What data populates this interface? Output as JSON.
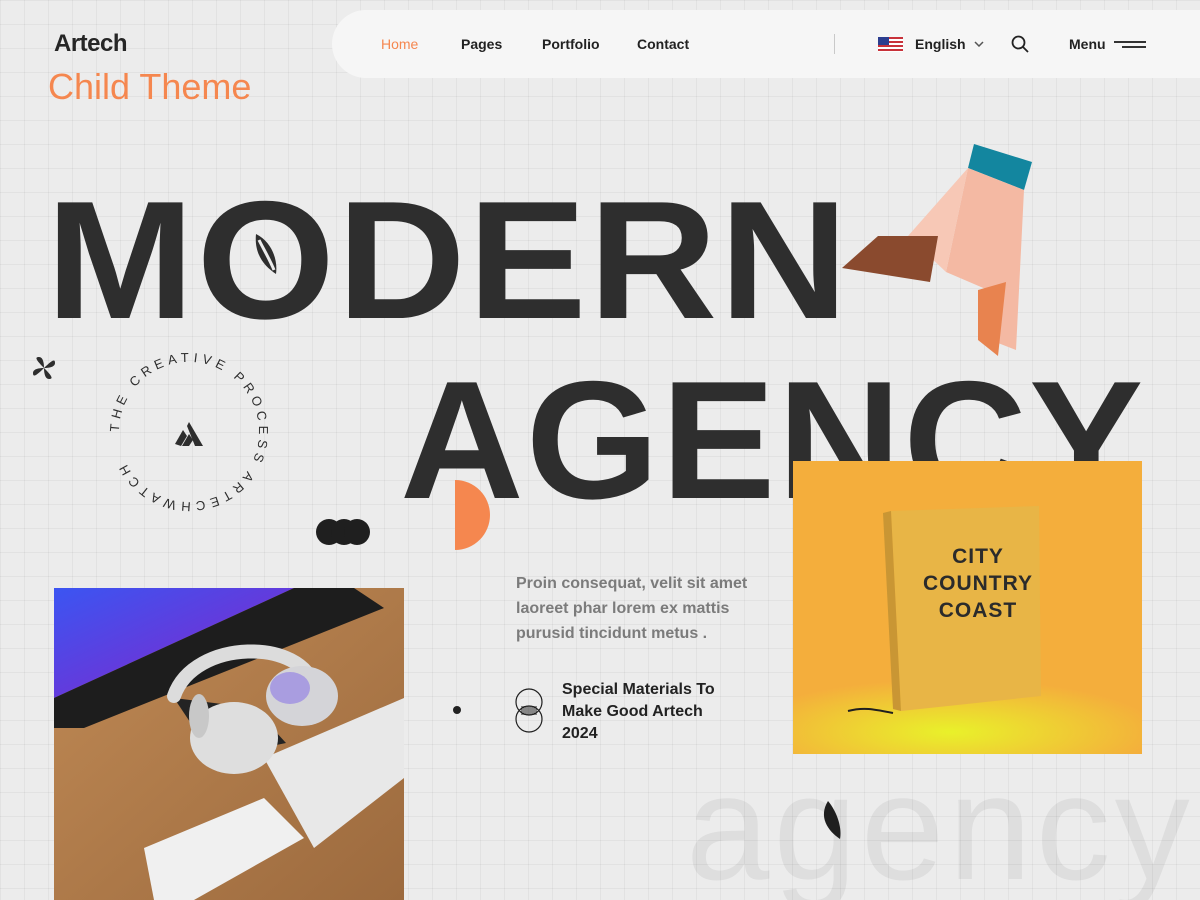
{
  "brand": {
    "logo": "Artech",
    "subtitle": "Child Theme"
  },
  "nav": {
    "items": [
      {
        "label": "Home",
        "active": true
      },
      {
        "label": "Pages",
        "active": false
      },
      {
        "label": "Portfolio",
        "active": false
      },
      {
        "label": "Contact",
        "active": false
      }
    ],
    "language": "English",
    "language_flag": "us-flag-icon",
    "menu_label": "Menu"
  },
  "hero": {
    "headline_1": "MODERN",
    "headline_2": "AGENCY",
    "badge_text": "THE CREATIVE PROCESS ARTECHWATCH",
    "body": "Proin consequat, velit sit amet laoreet phar lorem ex mattis purusid tincidunt metus .",
    "feature": "Special Materials To Make Good Artech 2024",
    "watermark": "agency"
  },
  "book": {
    "title_line_1": "CITY",
    "title_line_2": "COUNTRY",
    "title_line_3": "COAST"
  },
  "colors": {
    "accent": "#f5874f",
    "dark": "#2e2e2e",
    "teal": "#13869f",
    "peach": "#f4b9a3",
    "yellow": "#f4ae3c"
  }
}
